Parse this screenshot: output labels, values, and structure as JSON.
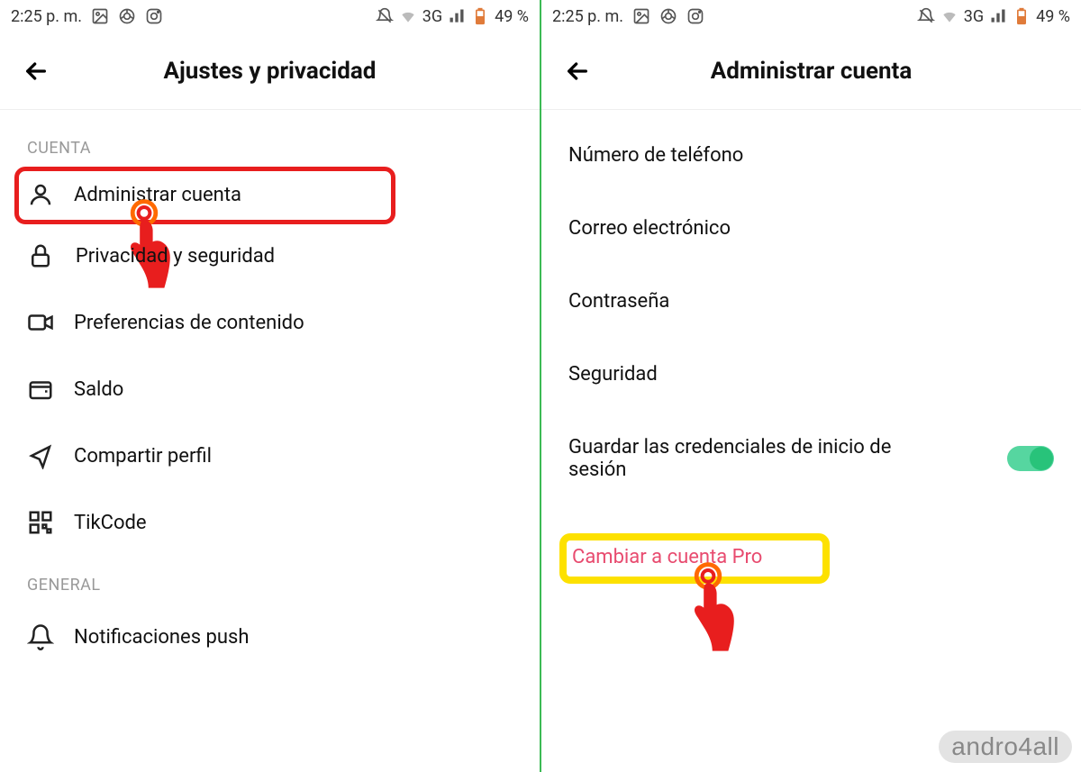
{
  "status": {
    "time": "2:25 p. m.",
    "network": "3G",
    "battery": "49 %"
  },
  "left": {
    "title": "Ajustes y privacidad",
    "sections": {
      "account_label": "CUENTA",
      "items": {
        "manage": "Administrar cuenta",
        "privacy": "Privacidad y seguridad",
        "content": "Preferencias de contenido",
        "balance": "Saldo",
        "share": "Compartir perfil",
        "tikcode": "TikCode"
      },
      "general_label": "GENERAL",
      "general": {
        "push": "Notificaciones push"
      }
    }
  },
  "right": {
    "title": "Administrar cuenta",
    "items": {
      "phone": "Número de teléfono",
      "email": "Correo electrónico",
      "password": "Contraseña",
      "security": "Seguridad",
      "save_credentials": "Guardar las credenciales de inicio de sesión"
    },
    "pro": "Cambiar a cuenta Pro"
  },
  "watermark": "andro4all"
}
